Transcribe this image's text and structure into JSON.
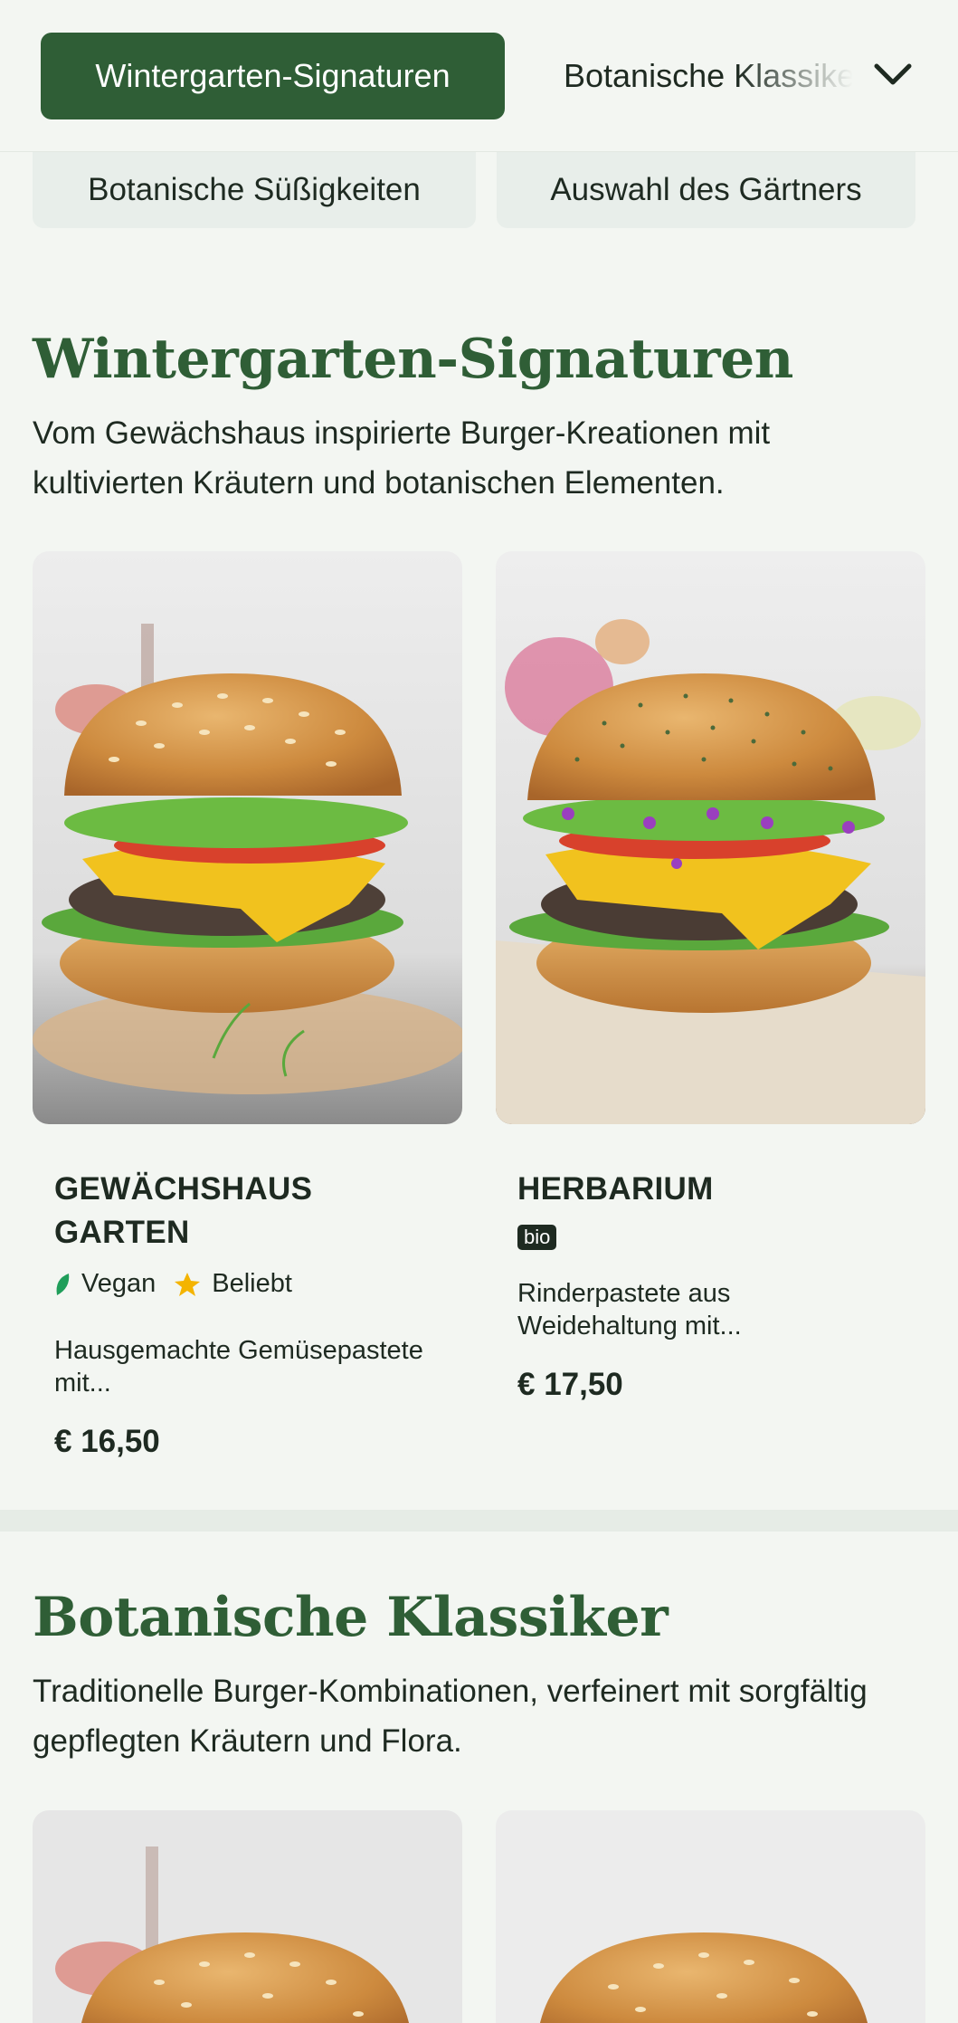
{
  "tabs": {
    "active": "Wintergarten-Signaturen",
    "next": "Botanische Klassiker",
    "row2": [
      "Botanische Süßigkeiten",
      "Auswahl des Gärtners"
    ]
  },
  "sections": [
    {
      "title": "Wintergarten-Signaturen",
      "description": "Vom Gewächshaus inspirierte Burger-Kreationen mit kultivierten Kräutern und botanischen Elementen.",
      "items": [
        {
          "name": "Gewächshaus Garten",
          "tags": [
            {
              "icon": "leaf-icon",
              "label": "Vegan"
            },
            {
              "icon": "star-icon",
              "label": "Beliebt"
            }
          ],
          "description": "Hausgemachte Gemüsepastete mit...",
          "price": "€ 16,50"
        },
        {
          "name": "Herbarium",
          "badge": "bio",
          "description": "Rinderpastete aus Weidehaltung mit...",
          "price": "€ 17,50"
        }
      ]
    },
    {
      "title": "Botanische Klassiker",
      "description": "Traditionelle Burger-Kombinationen, verfeinert mit sorgfältig gepflegten Kräutern und Flora."
    }
  ],
  "colors": {
    "accent": "#2f5e36",
    "background": "#f3f6f2",
    "text": "#1e2a21",
    "vegan": "#1f9e5a",
    "star": "#f4b400"
  }
}
